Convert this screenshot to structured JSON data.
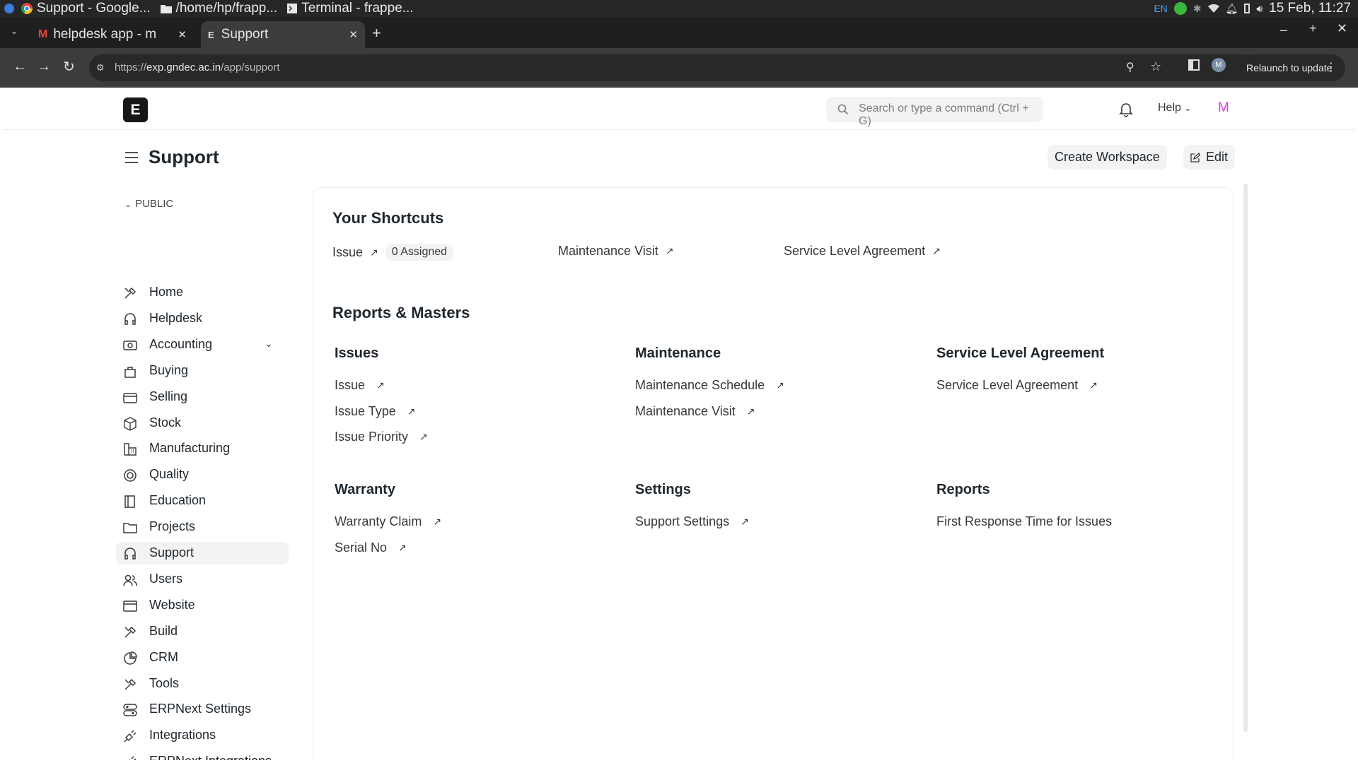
{
  "os_taskbar": {
    "apps": [
      "Support - Google...",
      "/home/hp/frapp...",
      "Terminal - frappe..."
    ],
    "language": "EN",
    "datetime": "15 Feb, 11:27"
  },
  "browser": {
    "tabs": [
      {
        "label": "helpdesk app - m"
      },
      {
        "label": "Support"
      }
    ],
    "url_prefix": "https://",
    "url_host": "exp.gndec.ac.in",
    "url_path": "/app/support",
    "profile_initial": "M",
    "relaunch_label": "Relaunch to update"
  },
  "navbar": {
    "logo_letter": "E",
    "search_placeholder": "Search or type a command (Ctrl + G)",
    "help_label": "Help",
    "avatar_initial": "M"
  },
  "page": {
    "title": "Support",
    "create_workspace_label": "Create Workspace",
    "edit_label": "Edit"
  },
  "sidebar": {
    "section_label": "PUBLIC",
    "items": [
      {
        "label": "Home",
        "icon": "tools-icon"
      },
      {
        "label": "Helpdesk",
        "icon": "headset-icon"
      },
      {
        "label": "Accounting",
        "icon": "money-icon"
      },
      {
        "label": "Buying",
        "icon": "bag-icon"
      },
      {
        "label": "Selling",
        "icon": "card-icon"
      },
      {
        "label": "Stock",
        "icon": "box-icon"
      },
      {
        "label": "Manufacturing",
        "icon": "factory-icon"
      },
      {
        "label": "Quality",
        "icon": "badge-icon"
      },
      {
        "label": "Education",
        "icon": "book-icon"
      },
      {
        "label": "Projects",
        "icon": "folder-icon"
      },
      {
        "label": "Support",
        "icon": "headset-icon"
      },
      {
        "label": "Users",
        "icon": "users-icon"
      },
      {
        "label": "Website",
        "icon": "browser-icon"
      },
      {
        "label": "Build",
        "icon": "tools-icon"
      },
      {
        "label": "CRM",
        "icon": "pie-icon"
      },
      {
        "label": "Tools",
        "icon": "tools-icon"
      },
      {
        "label": "ERPNext Settings",
        "icon": "settings-icon"
      },
      {
        "label": "Integrations",
        "icon": "plug-icon"
      },
      {
        "label": "ERPNext Integrations",
        "icon": "plug-icon"
      }
    ],
    "active": "Support"
  },
  "shortcuts": {
    "title": "Your Shortcuts",
    "items": [
      {
        "label": "Issue",
        "badge": "0 Assigned"
      },
      {
        "label": "Maintenance Visit"
      },
      {
        "label": "Service Level Agreement"
      }
    ]
  },
  "reports": {
    "title": "Reports & Masters",
    "cards": [
      {
        "title": "Issues",
        "links": [
          "Issue",
          "Issue Type",
          "Issue Priority"
        ]
      },
      {
        "title": "Maintenance",
        "links": [
          "Maintenance Schedule",
          "Maintenance Visit"
        ]
      },
      {
        "title": "Service Level Agreement",
        "links": [
          "Service Level Agreement"
        ]
      },
      {
        "title": "Warranty",
        "links": [
          "Warranty Claim",
          "Serial No"
        ]
      },
      {
        "title": "Settings",
        "links": [
          "Support Settings"
        ]
      },
      {
        "title": "Reports",
        "links": [
          "First Response Time for Issues"
        ]
      }
    ]
  }
}
